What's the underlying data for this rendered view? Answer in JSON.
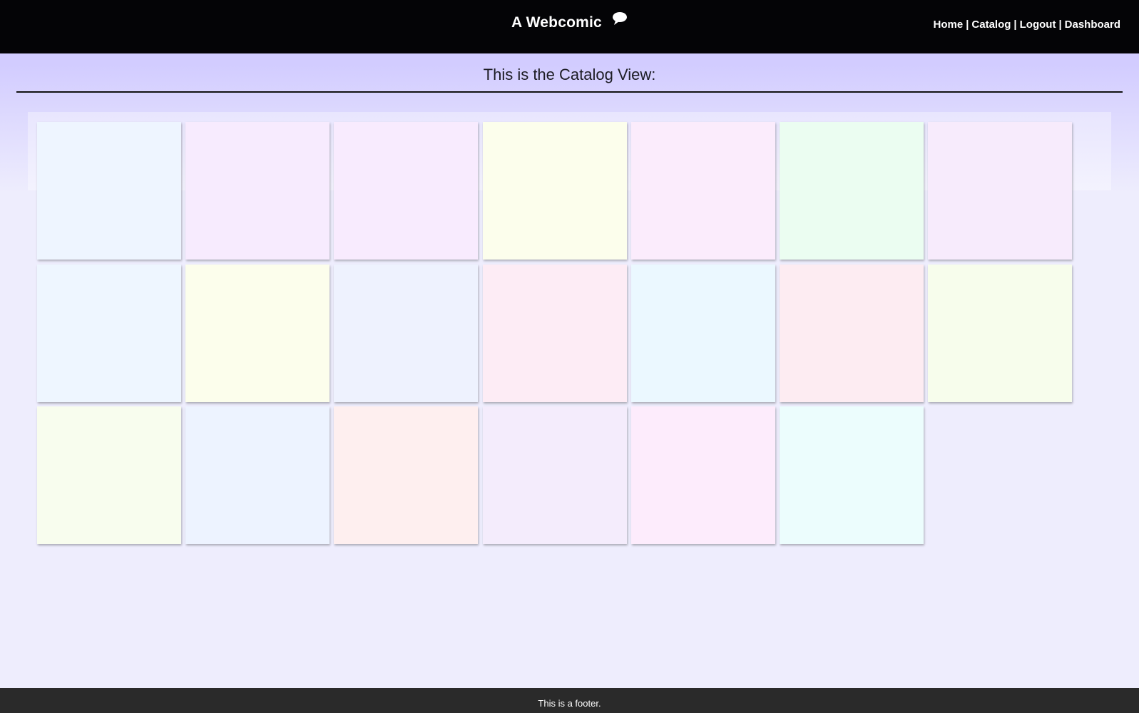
{
  "header": {
    "title": "A Webcomic",
    "title_icon": "speech-bubble-icon",
    "nav": [
      {
        "label": "Home"
      },
      {
        "label": "Catalog"
      },
      {
        "label": "Logout"
      },
      {
        "label": "Dashboard"
      }
    ],
    "nav_separator": "|"
  },
  "main": {
    "heading": "This is the Catalog View:",
    "tiles": [
      {
        "color": "#eef5ff"
      },
      {
        "color": "#f7ebfe"
      },
      {
        "color": "#f8ebfe"
      },
      {
        "color": "#fcfeec"
      },
      {
        "color": "#fbecfc"
      },
      {
        "color": "#ebfdf1"
      },
      {
        "color": "#f7ebfc"
      },
      {
        "color": "#eef6ff"
      },
      {
        "color": "#fcfeec"
      },
      {
        "color": "#eef2fe"
      },
      {
        "color": "#fdecf5"
      },
      {
        "color": "#ebf8ff"
      },
      {
        "color": "#fdecf2"
      },
      {
        "color": "#f7fdec"
      },
      {
        "color": "#f8fdee"
      },
      {
        "color": "#edf3ff"
      },
      {
        "color": "#feefef"
      },
      {
        "color": "#f4ecfc"
      },
      {
        "color": "#fdecfc"
      },
      {
        "color": "#ecfdfd"
      }
    ]
  },
  "footer": {
    "text": "This is a footer."
  }
}
